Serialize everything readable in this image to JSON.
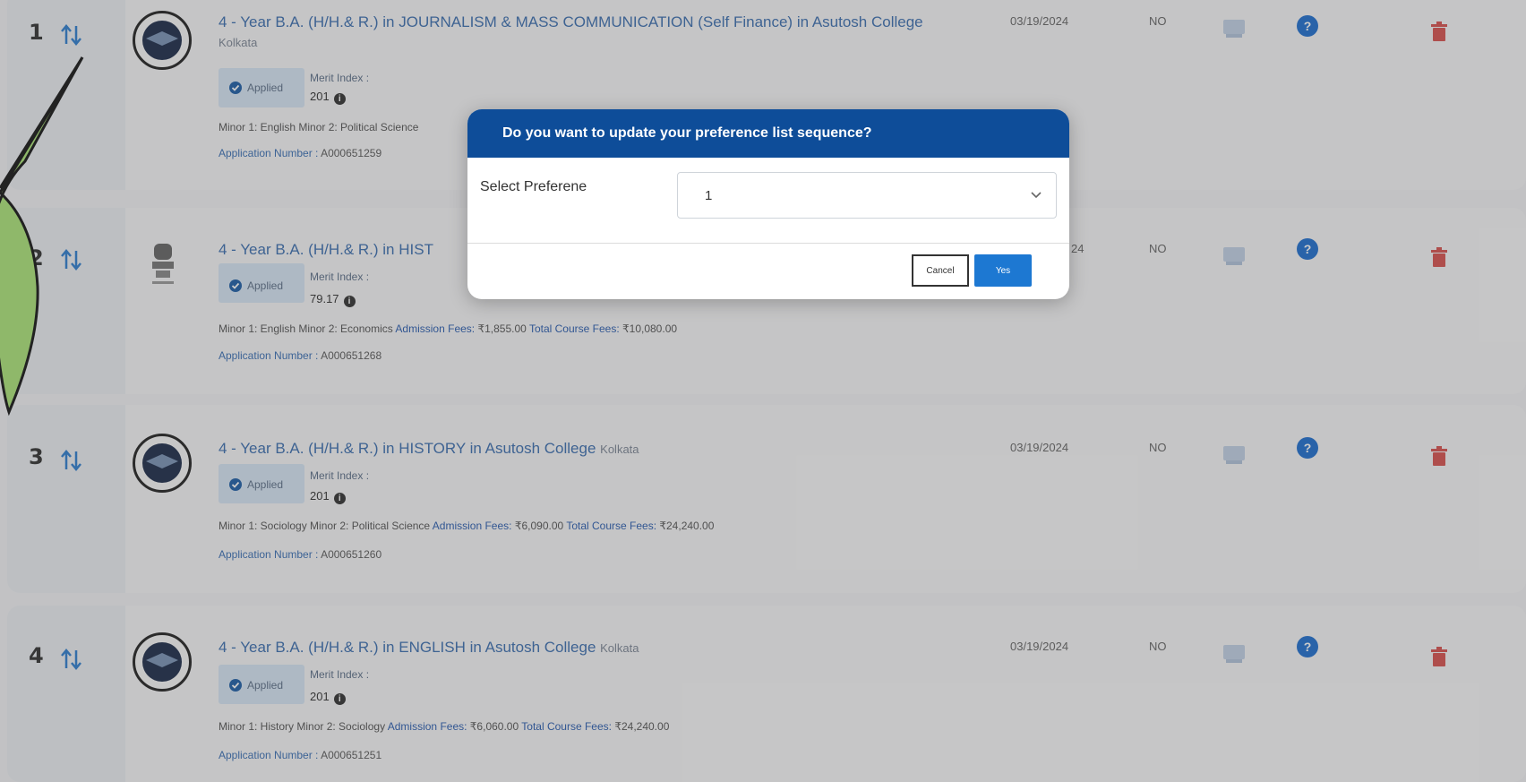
{
  "rows": [
    {
      "num": "1",
      "title": "4 - Year B.A. (H/H.& R.) in JOURNALISM & MASS COMMUNICATION (Self Finance) in Asutosh College",
      "place": "Kolkata",
      "status": "Applied",
      "merit_label": "Merit Index :",
      "merit_value": "201",
      "detail_minor": "Minor 1: English Minor 2: Political Science",
      "detail_fee_label": "",
      "detail_fee_value": "",
      "detail_total_label": "",
      "detail_total_value": "",
      "app_label": "Application Number :",
      "app_number": "A000651259",
      "date": "03/19/2024",
      "hostel": "NO",
      "logo": "college-crest"
    },
    {
      "num": "2",
      "title": "4 - Year B.A. (H/H.& R.) in HIST",
      "place": "",
      "status": "Applied",
      "merit_label": "Merit Index :",
      "merit_value": "79.17",
      "detail_minor": "Minor 1: English Minor 2: Economics",
      "detail_fee_label": "Admission Fees:",
      "detail_fee_value": "₹1,855.00",
      "detail_total_label": "Total Course Fees:",
      "detail_total_value": "₹10,080.00",
      "app_label": "Application Number :",
      "app_number": "A000651268",
      "date": "24",
      "hostel": "NO",
      "logo": "national-emblem"
    },
    {
      "num": "3",
      "title": "4 - Year B.A. (H/H.& R.) in HISTORY in Asutosh College",
      "place": "Kolkata",
      "status": "Applied",
      "merit_label": "Merit Index :",
      "merit_value": "201",
      "detail_minor": "Minor 1: Sociology Minor 2: Political Science",
      "detail_fee_label": "Admission Fees:",
      "detail_fee_value": "₹6,090.00",
      "detail_total_label": "Total Course Fees:",
      "detail_total_value": "₹24,240.00",
      "app_label": "Application Number :",
      "app_number": "A000651260",
      "date": "03/19/2024",
      "hostel": "NO",
      "logo": "college-crest"
    },
    {
      "num": "4",
      "title": "4 - Year B.A. (H/H.& R.) in ENGLISH in Asutosh College",
      "place": "Kolkata",
      "status": "Applied",
      "merit_label": "Merit Index :",
      "merit_value": "201",
      "detail_minor": "Minor 1: History Minor 2: Sociology",
      "detail_fee_label": "Admission Fees:",
      "detail_fee_value": "₹6,060.00",
      "detail_total_label": "Total Course Fees:",
      "detail_total_value": "₹24,240.00",
      "app_label": "Application Number :",
      "app_number": "A000651251",
      "date": "03/19/2024",
      "hostel": "NO",
      "logo": "college-crest"
    }
  ],
  "modal": {
    "title": "Do you want to update your preference list sequence?",
    "field_label": "Select Preferene",
    "selected_value": "1",
    "cancel_label": "Cancel",
    "yes_label": "Yes"
  },
  "colors": {
    "modal_header": "#0e4d99",
    "yes_button": "#1d78d2",
    "trash": "#d9534f",
    "link": "#3c6fb0",
    "callout": "#8fb86a"
  },
  "icons": [
    "sort-arrows-icon",
    "check-circle-icon",
    "info-icon",
    "document-icon",
    "question-icon",
    "trash-icon",
    "chevron-down-icon"
  ]
}
